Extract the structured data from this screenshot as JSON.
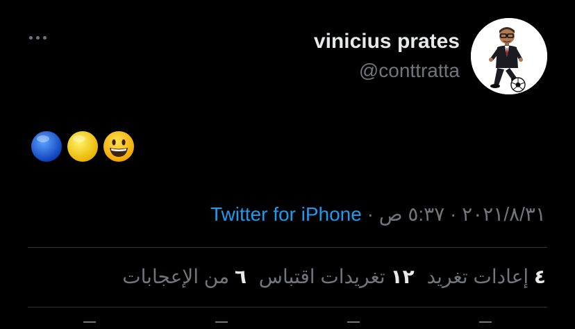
{
  "tweet": {
    "author": {
      "display_name": "vinicius prates",
      "handle": "@conttratta",
      "avatar": "bitmoji-avatar-with-soccer-ball"
    },
    "more_menu_icon": "ellipsis-icon",
    "body": {
      "emojis": [
        "blue-circle",
        "yellow-circle",
        "grinning-face"
      ]
    },
    "meta": {
      "date": "٢٠٢١/٨/٣١",
      "separator": "·",
      "time": "٥:٣٧ ص",
      "source": "Twitter for iPhone"
    },
    "stats": {
      "retweets_count": "٤",
      "retweets_label": "إعادات تغريد",
      "quotes_count": "١٢",
      "quotes_label": "تغريدات اقتباس",
      "likes_count": "٦",
      "likes_label": "من الإعجابات"
    }
  },
  "colors": {
    "background": "#000000",
    "primary_text": "#e7e9ea",
    "secondary_text": "#71767b",
    "link": "#1d9bf0",
    "divider": "#2f3336"
  }
}
